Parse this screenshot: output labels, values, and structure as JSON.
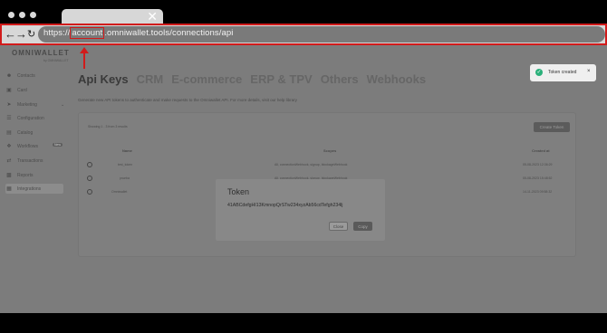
{
  "browser": {
    "url_prefix": "https://",
    "url_highlight": "account",
    "url_rest": ".omniwallet.tools/connections/api",
    "back_glyph": "←",
    "forward_glyph": "→",
    "reload_glyph": "↻",
    "tab_close_glyph": "✕"
  },
  "app": {
    "logo": "OMNIWALLET",
    "logo_sub": "by OMNIWALLET",
    "sidebar": [
      {
        "label": "Contacts",
        "icon": "user-icon"
      },
      {
        "label": "Card",
        "icon": "card-icon"
      },
      {
        "label": "Marketing",
        "icon": "megaphone-icon"
      },
      {
        "label": "Configuration",
        "icon": "sliders-icon"
      },
      {
        "label": "Catalog",
        "icon": "catalog-icon"
      },
      {
        "label": "Workflows",
        "icon": "workflow-icon",
        "badge": "New"
      },
      {
        "label": "Transactions",
        "icon": "transactions-icon"
      },
      {
        "label": "Reports",
        "icon": "chart-icon"
      },
      {
        "label": "Integrations",
        "icon": "integrations-icon"
      }
    ],
    "tabs": [
      "Api Keys",
      "CRM",
      "E-commerce",
      "ERP & TPV",
      "Others",
      "Webhooks"
    ],
    "description": "Generate new API tokens to authenticate and make requests to the Omniwallet API. For more details, visit our help library",
    "table": {
      "showing": "Showing 1 - 3 from 3 results",
      "create_label": "Create Token",
      "headers": [
        "Name",
        "Scopes",
        "Created at"
      ],
      "rows": [
        {
          "name": "test_token",
          "scopes": "All, connectionWebhook, signup, blockageWebhook",
          "created": "05-08-2023 12:36:29"
        },
        {
          "name": "prueba",
          "scopes": "All, connectionWebhook, signup, blockageWebhook",
          "created": "05-08-2023 15:48:52"
        },
        {
          "name": "Omniwallet",
          "scopes": "All, connectionWebhook, signup, blockageWebhook, stampsWebhook",
          "created": "14-11-2023 09:58:32"
        }
      ]
    },
    "toast": {
      "text": "Token created",
      "close": "×"
    },
    "modal": {
      "title": "Token",
      "token": "41ABCdefgHI13KmnopQrSTw234xyzAb56cdTefgh234lj",
      "close_label": "Close",
      "copy_label": "Copy"
    }
  }
}
